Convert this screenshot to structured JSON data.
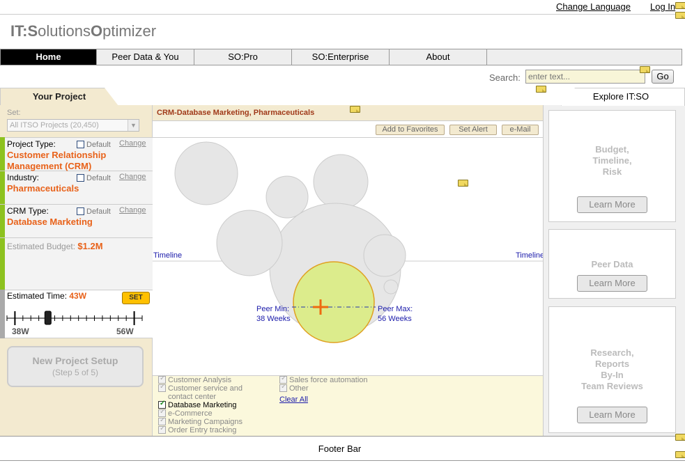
{
  "header": {
    "change_language": "Change Language",
    "log_in": "Log In",
    "logo": {
      "a": "IT:",
      "b": "S",
      "c": "olutions",
      "d": "O",
      "e": "ptimizer"
    }
  },
  "nav": {
    "tabs": [
      {
        "label": "Home",
        "active": true
      },
      {
        "label": "Peer Data & You",
        "active": false
      },
      {
        "label": "SO:Pro",
        "active": false
      },
      {
        "label": "SO:Enterprise",
        "active": false
      },
      {
        "label": "About",
        "active": false
      }
    ]
  },
  "search": {
    "label": "Search:",
    "placeholder": "enter text...",
    "go": "Go"
  },
  "left": {
    "tab_title": "Your Project",
    "set_label": "Set:",
    "set_value": "All ITSO Projects (20,450)",
    "project_type": {
      "label": "Project Type:",
      "default": "Default",
      "change": "Change",
      "value_line1": "Customer Relationship",
      "value_line2": "Management (CRM)"
    },
    "industry": {
      "label": "Industry:",
      "default": "Default",
      "change": "Change",
      "value": "Pharmaceuticals"
    },
    "crm_type": {
      "label": "CRM Type:",
      "default": "Default",
      "change": "Change",
      "value": "Database Marketing"
    },
    "budget": {
      "label": "Estimated Budget:",
      "value": "$1.2M"
    },
    "time": {
      "label": "Estimated Time:",
      "value": "43W",
      "set": "SET",
      "min": "38W",
      "max": "56W",
      "slider_position_fraction": 0.28
    },
    "setup": {
      "title": "New Project Setup",
      "step": "(Step 5 of 5)"
    }
  },
  "center": {
    "title": "CRM-Database Marketing, Pharmaceuticals",
    "actions": {
      "favorites": "Add to Favorites",
      "alert": "Set Alert",
      "email": "e-Mail"
    },
    "timeline_left": "Timeline",
    "timeline_right": "Timeline",
    "peer_min_label": "Peer Min:",
    "peer_min_value": "38 Weeks",
    "peer_max_label": "Peer Max:",
    "peer_max_value": "56  Weeks",
    "filters_col1": [
      {
        "label": "Customer Analysis",
        "checked": false
      },
      {
        "label": "Customer service and",
        "checked": false
      },
      {
        "label": "contact center",
        "checked": false,
        "continuation": true
      },
      {
        "label": "Database Marketing",
        "checked": true
      },
      {
        "label": "e-Commerce",
        "checked": false
      },
      {
        "label": "Marketing Campaigns",
        "checked": false
      },
      {
        "label": "Order Entry tracking",
        "checked": false
      }
    ],
    "filters_col2": [
      {
        "label": "Sales force automation",
        "checked": false
      },
      {
        "label": "Other",
        "checked": false
      }
    ],
    "clear_all": "Clear All"
  },
  "right": {
    "tab_title": "Explore IT:SO",
    "cards": [
      {
        "title": "Budget,\nTimeline,\nRisk",
        "button": "Learn More"
      },
      {
        "title": "Peer Data",
        "button": "Learn More"
      },
      {
        "title": "Research,\nReports\nBy-In\nTeam Reviews",
        "button": "Learn More"
      }
    ]
  },
  "footer": {
    "label": "Footer Bar"
  },
  "colors": {
    "orange": "#e8621a",
    "tan_panel": "#f3ead0",
    "green_bar": "#8dc21f",
    "bubble_fill": "#dcec8c",
    "bubble_stroke": "#e0a020",
    "link_blue": "#1a1aaa"
  }
}
